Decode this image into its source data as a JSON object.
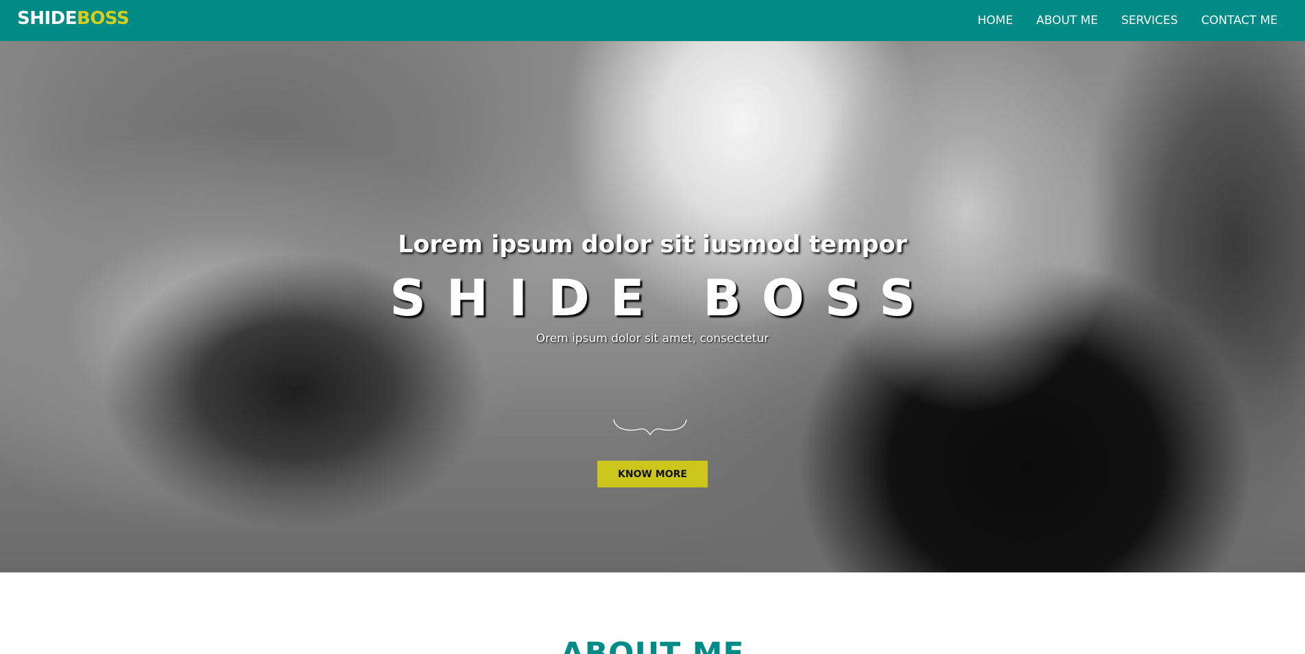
{
  "navbar": {
    "brand_part1": "SHIDE",
    "brand_part2": "BOSS",
    "links": [
      "HOME",
      "ABOUT ME",
      "SERVICES",
      "CONTACT ME"
    ],
    "background_color": "#008b87",
    "brand_accent_color": "#d4cf1f"
  },
  "hero": {
    "kicker": "Lorem ipsum dolor sit iusmod tempor",
    "title": "SHIDE BOSS",
    "subtitle": "Orem ipsum dolor sit amet, consectetur",
    "divider_icon": "curly-divider-icon",
    "cta_label": "KNOW MORE",
    "cta_color": "#ccc51c",
    "background_description_icon": "grayscale-photo-background"
  },
  "about": {
    "heading": "ABOUT ME",
    "heading_color": "#008b87"
  }
}
